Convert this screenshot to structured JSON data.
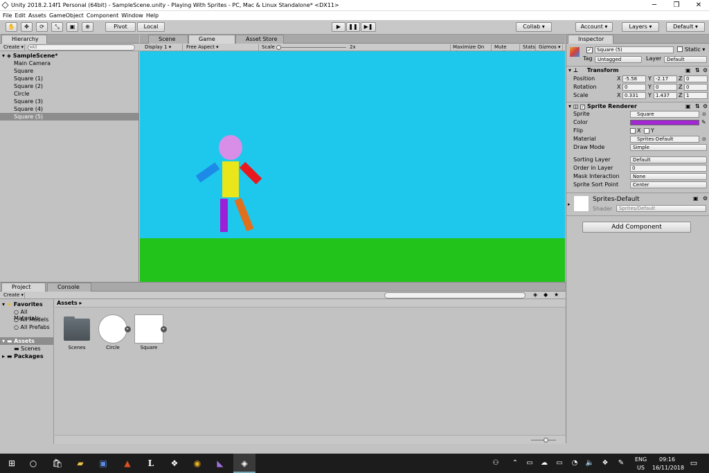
{
  "window": {
    "title": "Unity 2018.2.14f1 Personal (64bit) - SampleScene.unity - Playing With Sprites - PC, Mac & Linux Standalone* <DX11>"
  },
  "menu": [
    "File",
    "Edit",
    "Assets",
    "GameObject",
    "Component",
    "Window",
    "Help"
  ],
  "toolbar": {
    "pivot": "Pivot",
    "local": "Local",
    "collab": "Collab ▾",
    "account": "Account ▾",
    "layers": "Layers ▾",
    "layout": "Default ▾"
  },
  "hierarchy": {
    "tab": "Hierarchy",
    "create": "Create ▾",
    "search_placeholder": "▾All",
    "scene": "SampleScene*",
    "items": [
      "Main Camera",
      "Square",
      "Square (1)",
      "Square (2)",
      "Circle",
      "Square (3)",
      "Square (4)",
      "Square (5)"
    ],
    "selected": "Square (5)"
  },
  "views": {
    "tabs": [
      "Scene",
      "Game",
      "Asset Store"
    ],
    "display": "Display 1 ▾",
    "aspect": "Free Aspect ▾",
    "scale_label": "Scale",
    "scale_value": "2x",
    "buttons": [
      "Maximize On Play",
      "Mute Audio",
      "Stats",
      "Gizmos ▾"
    ]
  },
  "game": {
    "sky": "#1ec8ec",
    "ground": "#22c41c",
    "head": "#d88ee6",
    "torso": "#e9e61a",
    "left_arm": "#1e8ae8",
    "right_arm": "#e8191e",
    "left_leg": "#9b20d6",
    "right_leg": "#e0701e"
  },
  "inspector": {
    "tab": "Inspector",
    "name": "Square (5)",
    "static": "Static ▾",
    "tag_label": "Tag",
    "tag": "Untagged",
    "layer_label": "Layer",
    "layer": "Default",
    "transform": {
      "title": "Transform",
      "position": {
        "label": "Position",
        "x": "-5.58",
        "y": "-2.17",
        "z": "0"
      },
      "rotation": {
        "label": "Rotation",
        "x": "0",
        "y": "0",
        "z": "0"
      },
      "scale": {
        "label": "Scale",
        "x": "0.331",
        "y": "1.437",
        "z": "1"
      }
    },
    "sprite_renderer": {
      "title": "Sprite Renderer",
      "sprite_label": "Sprite",
      "sprite": "Square",
      "color_label": "Color",
      "color": "#a427d4",
      "flip_label": "Flip",
      "flip_x": "X",
      "flip_y": "Y",
      "material_label": "Material",
      "material": "Sprites-Default",
      "draw_mode_label": "Draw Mode",
      "draw_mode": "Simple",
      "sorting_layer_label": "Sorting Layer",
      "sorting_layer": "Default",
      "order_label": "Order in Layer",
      "order": "0",
      "mask_label": "Mask Interaction",
      "mask": "None",
      "pivot_label": "Sprite Sort Point",
      "pivot": "Center"
    },
    "material": {
      "name": "Sprites-Default",
      "shader_label": "Shader",
      "shader": "Sprites/Default"
    },
    "add_component": "Add Component"
  },
  "project": {
    "tabs": [
      "Project",
      "Console"
    ],
    "create": "Create ▾",
    "favorites": {
      "label": "Favorites",
      "items": [
        "All Materials",
        "All Models",
        "All Prefabs"
      ]
    },
    "tree": {
      "assets": "Assets",
      "scenes": "Scenes",
      "packages": "Packages"
    },
    "breadcrumb": "Assets ▸",
    "assets": [
      {
        "name": "Scenes",
        "kind": "folder"
      },
      {
        "name": "Circle",
        "kind": "circle"
      },
      {
        "name": "Square",
        "kind": "square"
      }
    ]
  },
  "taskbar": {
    "lang": "ENG",
    "region": "US",
    "time": "09:16",
    "date": "16/11/2018"
  }
}
